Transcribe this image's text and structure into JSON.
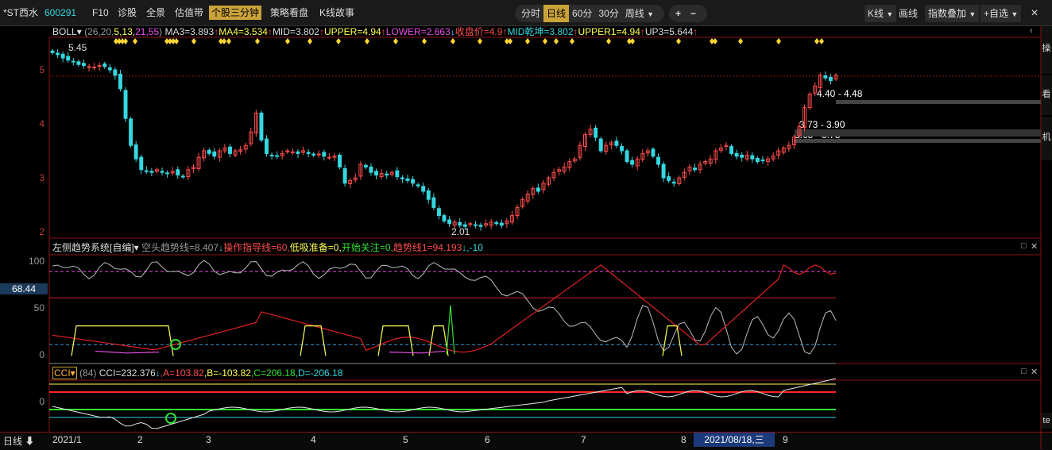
{
  "toolbar": {
    "stock_name": "*ST西水",
    "stock_code": "600291",
    "items": [
      "F10",
      "诊股",
      "全景",
      "估值带"
    ],
    "active_item": "个股三分钟",
    "items2": [
      "策略看盘",
      "K线故事"
    ],
    "periods": [
      "分时",
      "日线",
      "60分",
      "30分"
    ],
    "active_period": "日线",
    "weekly": "周线",
    "zoom_in": "+",
    "zoom_out": "−",
    "kline_btn": "K线",
    "draw_btn": "画线",
    "index_overlay_btn": "指数叠加",
    "add_favorite_btn": "+自选",
    "close_icon": "×"
  },
  "boll_info": {
    "name": "BOLL",
    "params_prefix": "(26,20,",
    "param2": "5,13,",
    "param3": "21,55",
    "params_suffix": ")",
    "ma3": "MA3=3.893",
    "ma4": "MA4=3.534",
    "mid": "MID=3.802",
    "upper": "UPPER=4.94",
    "lower": "LOWER=2.663",
    "close": "收盘价=4.9",
    "mid_dry": "MID乾坤=3.802",
    "upper1": "UPPER1=4.94",
    "up3": "UP3=5.644"
  },
  "main_chart": {
    "y_ticks": [
      "5",
      "4",
      "3",
      "2"
    ],
    "high_label": "5.45",
    "low_label": "2.01",
    "gap_labels": [
      "4.40 - 4.48",
      "3.73 - 3.90",
      "3.65 - 3.73"
    ]
  },
  "trend_info": {
    "name": "左侧趋势系统[自编]",
    "bear_line": "空头趋势线=8.407",
    "op_line": "操作指导线=60",
    "absorb": "低吸准备=0",
    "start_watch": "开始关注=0",
    "trend_line": "趋势线1=94.193",
    "tail": "-10"
  },
  "trend_panel": {
    "y_ticks": [
      "100",
      "50",
      "0"
    ],
    "current_value": "68.44"
  },
  "cci_info": {
    "name": "CCI",
    "param": "(84)",
    "cci": "CCI=232.376",
    "a": "A=103.82",
    "b": "B=-103.82",
    "c": "C=206.18",
    "d": "D=-206.18"
  },
  "cci_panel": {
    "y_ticks": [
      "0"
    ]
  },
  "x_axis": {
    "period_label": "日线",
    "labels": [
      "2021/1",
      "2",
      "3",
      "4",
      "5",
      "6",
      "7",
      "8",
      "9"
    ],
    "cursor_date": "2021/08/18,三"
  },
  "sidebar": {
    "labels": [
      "操",
      "看",
      "机",
      "te"
    ]
  },
  "colors": {
    "up": "#ff4d4d",
    "down": "#35d7e0",
    "border": "#8a1212",
    "accent": "#c9a23a",
    "white": "#e8e8e8",
    "yellow": "#ffff55",
    "magenta": "#e84de8",
    "green": "#33e033"
  },
  "chart_data": {
    "type": "candlestick",
    "period": "daily",
    "x_labels": [
      "2021/1",
      "2",
      "3",
      "4",
      "5",
      "6",
      "7",
      "8",
      "9"
    ],
    "y_range": [
      1.9,
      5.6
    ],
    "y_ticks": [
      2,
      3,
      4,
      5
    ],
    "annotations": [
      "5.45",
      "2.01",
      "4.40 - 4.48",
      "3.73 - 3.90",
      "3.65 - 3.73"
    ],
    "series": [
      {
        "name": "close",
        "values": [
          5.32,
          5.28,
          5.22,
          5.18,
          5.15,
          5.1,
          5.08,
          5.06,
          5.05,
          5.08,
          5.06,
          5.0,
          4.9,
          4.65,
          4.1,
          3.6,
          3.35,
          3.15,
          3.12,
          3.1,
          3.15,
          3.1,
          3.08,
          3.12,
          3.05,
          3.02,
          3.15,
          3.2,
          3.38,
          3.5,
          3.45,
          3.4,
          3.5,
          3.55,
          3.45,
          3.5,
          3.52,
          3.6,
          3.85,
          4.2,
          3.7,
          3.45,
          3.42,
          3.4,
          3.45,
          3.5,
          3.48,
          3.45,
          3.5,
          3.45,
          3.42,
          3.44,
          3.4,
          3.38,
          3.4,
          3.2,
          2.9,
          2.95,
          3.0,
          3.25,
          3.2,
          3.1,
          3.05,
          3.08,
          3.05,
          3.1,
          3.02,
          2.98,
          2.95,
          2.9,
          2.85,
          2.75,
          2.6,
          2.45,
          2.3,
          2.2,
          2.15,
          2.18,
          2.12,
          2.1,
          2.15,
          2.12,
          2.1,
          2.15,
          2.18,
          2.15,
          2.12,
          2.2,
          2.3,
          2.45,
          2.6,
          2.7,
          2.8,
          2.75,
          2.9,
          3.0,
          3.1,
          3.15,
          3.2,
          3.3,
          3.35,
          3.6,
          3.8,
          3.9,
          3.75,
          3.5,
          3.6,
          3.65,
          3.6,
          3.5,
          3.3,
          3.25,
          3.35,
          3.45,
          3.5,
          3.4,
          3.25,
          3.0,
          2.95,
          2.9,
          3.0,
          3.1,
          3.2,
          3.15,
          3.25,
          3.3,
          3.35,
          3.5,
          3.55,
          3.6,
          3.45,
          3.4,
          3.38,
          3.42,
          3.35,
          3.3,
          3.32,
          3.35,
          3.4,
          3.5,
          3.55,
          3.6,
          3.75,
          3.95,
          4.3,
          4.55,
          4.7,
          4.9,
          4.85,
          4.8,
          4.9
        ]
      }
    ],
    "indicator_panels": [
      {
        "name": "左侧趋势系统",
        "y_ticks": [
          100,
          50,
          0
        ],
        "op_line": 60,
        "current": 68.44
      },
      {
        "name": "CCI",
        "period": 84,
        "cci": 232.376,
        "A": 103.82,
        "B": -103.82,
        "C": 206.18,
        "D": -206.18
      }
    ]
  }
}
